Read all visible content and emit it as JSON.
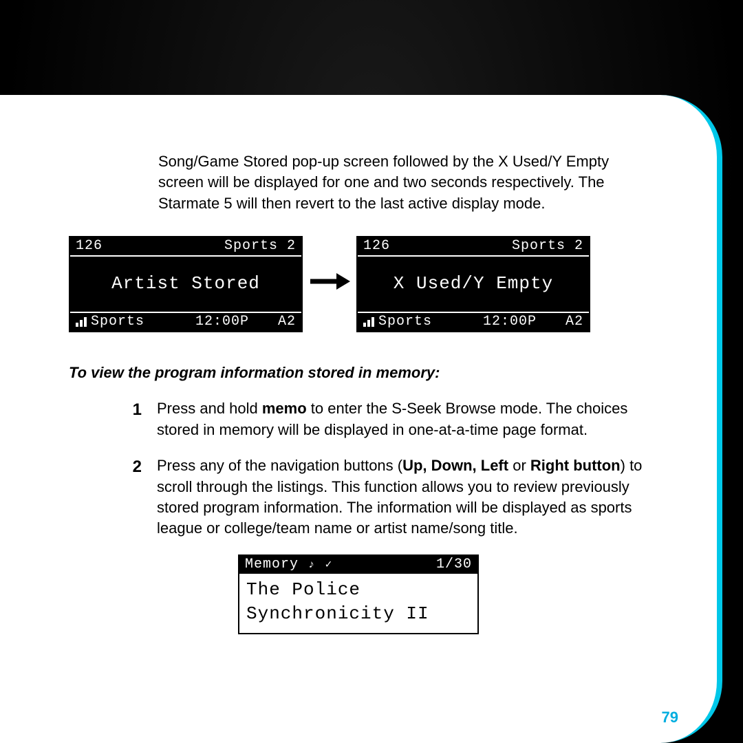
{
  "intro": "Song/Game Stored pop-up screen followed by the X Used/Y Empty screen will be displayed for one and two seconds respectively. The Starmate 5 will then revert to the last active display mode.",
  "lcd": {
    "left": {
      "channel": "126",
      "category_top": "Sports 2",
      "message": "Artist Stored",
      "category_bot": "Sports",
      "time": "12:00P",
      "preset": "A2"
    },
    "right": {
      "channel": "126",
      "category_top": "Sports 2",
      "message": "X Used/Y Empty",
      "category_bot": "Sports",
      "time": "12:00P",
      "preset": "A2"
    }
  },
  "subhead": "To view the program information stored in memory:",
  "steps": [
    {
      "num": "1",
      "pre": "Press and hold ",
      "b1": "memo",
      "post": " to enter the S-Seek Browse mode. The choices stored in memory will be displayed in one-at-a-time page format."
    },
    {
      "num": "2",
      "pre": "Press any of the navigation buttons (",
      "b1": "Up, Down, Left ",
      "mid": "or ",
      "b2": "Right button",
      "post": ") to scroll through the listings. This function allows you to review previously stored program information. The information will be displayed as sports league or college/team name or artist name/song title."
    }
  ],
  "memory": {
    "label": "Memory",
    "count": "1/30",
    "line1": "The Police",
    "line2": "Synchronicity II"
  },
  "page_number": "79"
}
